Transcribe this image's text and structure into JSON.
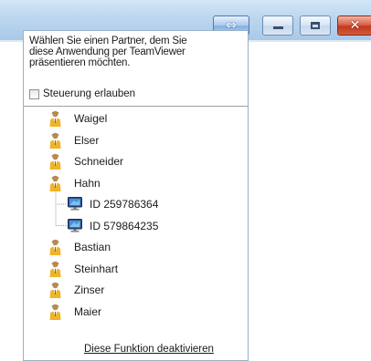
{
  "window": {
    "teamviewer_button_icon": "double-arrow-icon",
    "minimize_icon": "minimize-icon",
    "maximize_icon": "maximize-icon",
    "close_icon": "close-icon"
  },
  "popup": {
    "message_lines": [
      "Wählen Sie einen Partner, dem Sie",
      "diese Anwendung per TeamViewer",
      "präsentieren möchten."
    ],
    "checkbox_label": "Steuerung erlauben",
    "checkbox_checked": false,
    "partners": [
      {
        "name": "Waigel",
        "icon": "person-icon"
      },
      {
        "name": "Elser",
        "icon": "person-icon"
      },
      {
        "name": "Schneider",
        "icon": "person-icon"
      },
      {
        "name": "Hahn",
        "icon": "person-icon",
        "devices": [
          {
            "label": "ID  259786364",
            "icon": "computer-icon"
          },
          {
            "label": "ID  579864235",
            "icon": "computer-icon"
          }
        ]
      },
      {
        "name": "Bastian",
        "icon": "person-icon"
      },
      {
        "name": "Steinhart",
        "icon": "person-icon"
      },
      {
        "name": "Zinser",
        "icon": "person-icon"
      },
      {
        "name": "Maier",
        "icon": "person-icon"
      }
    ],
    "footer_link": "Diese Funktion deaktivieren"
  },
  "colors": {
    "titlebar": "#bcd6ef",
    "close_button": "#c1391f",
    "popup_border": "#9ab1c7"
  }
}
